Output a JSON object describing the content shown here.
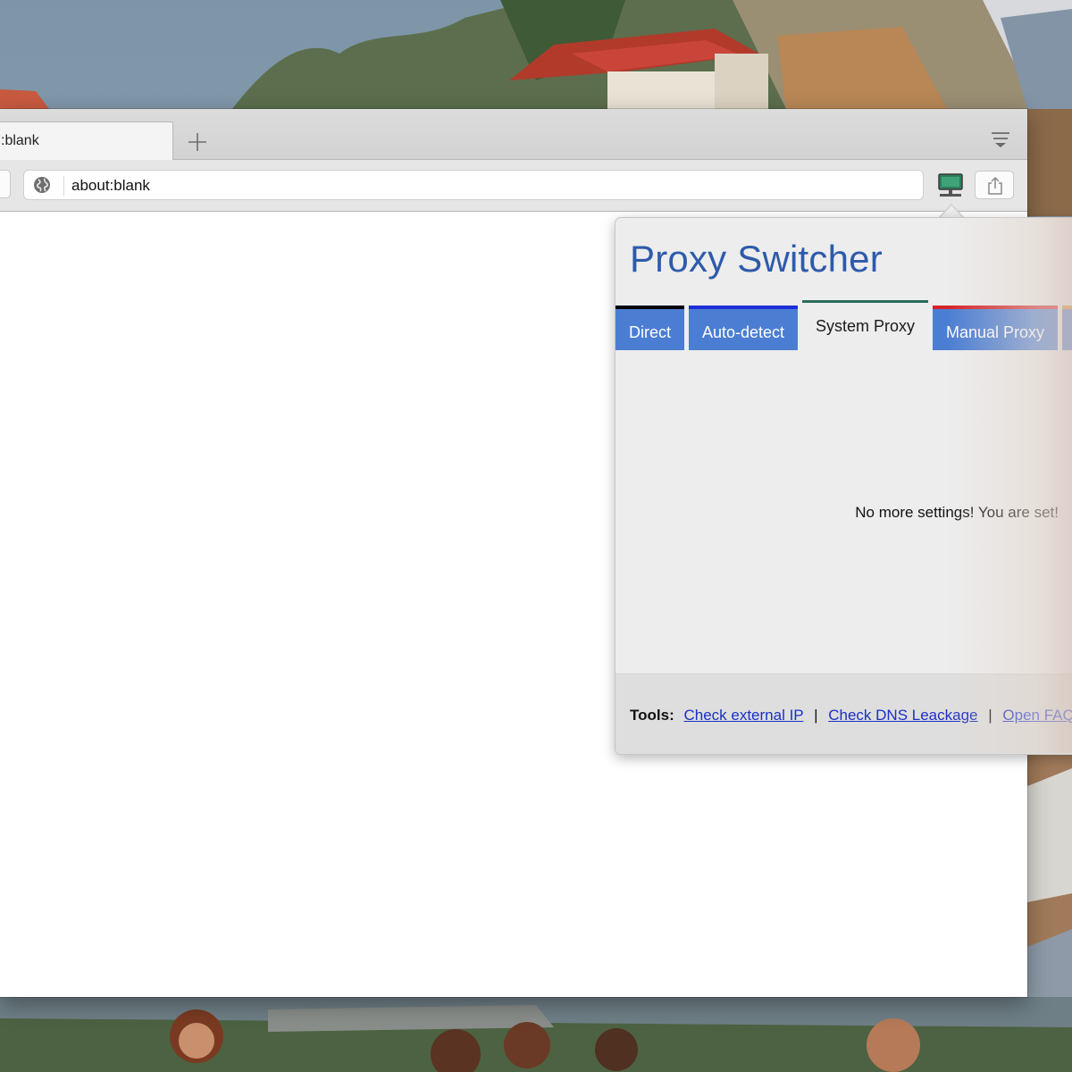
{
  "browser": {
    "tab": {
      "title": ":blank"
    },
    "url_bar": {
      "value": "about:blank"
    }
  },
  "extension_popup": {
    "title": "Proxy Switcher",
    "tabs": [
      {
        "label": "Direct",
        "accent": "#000000"
      },
      {
        "label": "Auto-detect",
        "accent": "#1d2fd6"
      },
      {
        "label": "System Proxy",
        "accent": "#2a6b5a",
        "active": true
      },
      {
        "label": "Manual Proxy",
        "accent": "#d6232a"
      }
    ],
    "message": "No more settings! You are set!",
    "footer": {
      "tools_label": "Tools:",
      "links": [
        "Check external IP",
        "Check DNS Leackage",
        "Open FAQ"
      ],
      "separator": "|"
    }
  },
  "colors": {
    "title_blue": "#2e5baa",
    "tab_blue": "#4b7ed3",
    "link_blue": "#1b2fc7",
    "popup_bg": "#ededed"
  },
  "icons": [
    "new-tab-icon",
    "tab-overview-icon",
    "globe-icon",
    "proxy-switcher-icon",
    "share-icon"
  ]
}
